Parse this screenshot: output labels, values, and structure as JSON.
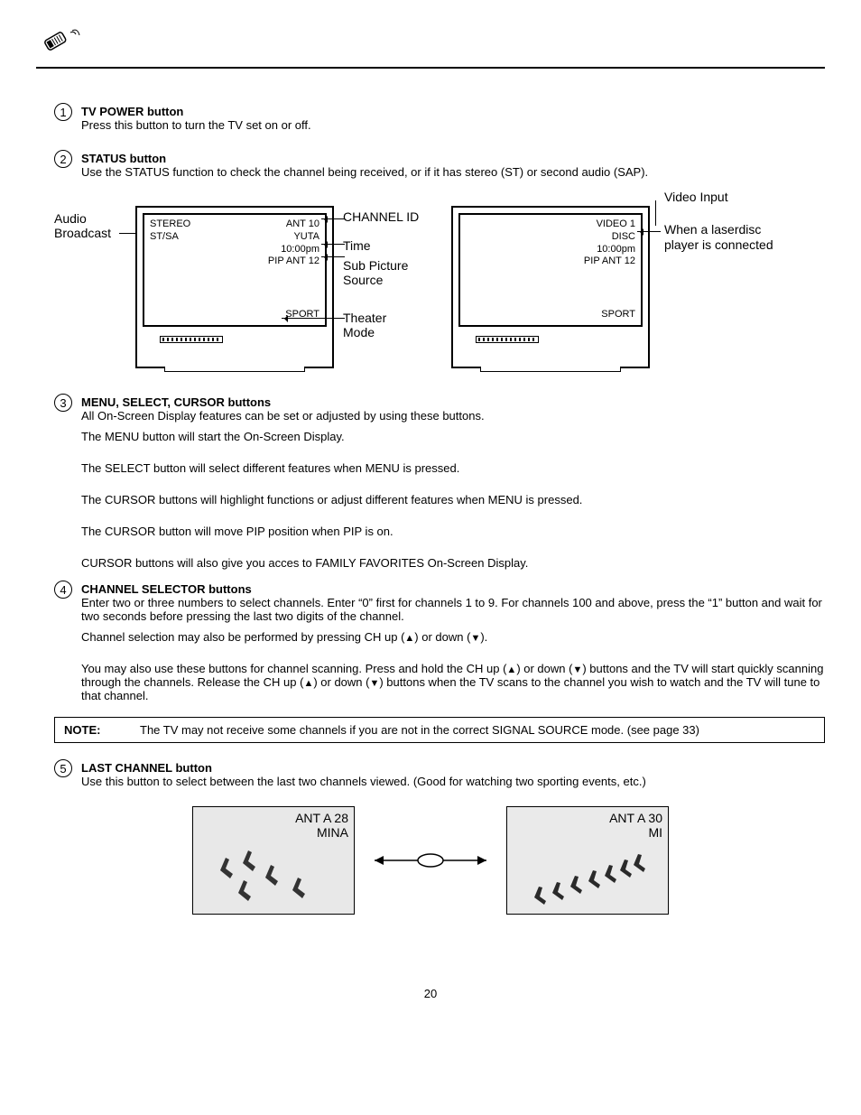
{
  "items": {
    "i1": {
      "num": "1",
      "title": "TV POWER button",
      "desc": "Press this button to turn the TV set on or off."
    },
    "i2": {
      "num": "2",
      "title": "STATUS button",
      "desc": "Use the STATUS function to check the channel being received, or if it has stereo (ST) or second audio (SAP)."
    },
    "i3": {
      "num": "3",
      "title": "MENU, SELECT, CURSOR buttons",
      "p1": "All On-Screen Display features can be set or adjusted by using these buttons.",
      "p2": "The MENU button will start the On-Screen Display.",
      "p3": "The SELECT button will select different features when MENU is pressed.",
      "p4": "The CURSOR buttons will highlight functions or adjust different features when MENU is pressed.",
      "p5": "The CURSOR button will move PIP position when PIP is on.",
      "p6": "CURSOR buttons will also give you acces to FAMILY FAVORITES On-Screen Display."
    },
    "i4": {
      "num": "4",
      "title": "CHANNEL SELECTOR buttons",
      "p1": "Enter two or three numbers to select channels.  Enter “0” first for channels 1 to 9.  For channels 100 and above, press the “1” button and wait for two seconds before pressing the last two digits of the channel.",
      "p2_a": "Channel selection may also be performed by pressing CH up (",
      "p2_b": ") or down (",
      "p2_c": ").",
      "p3_a": "You may also use these buttons for channel scanning.  Press and hold the CH up (",
      "p3_b": ") or down (",
      "p3_c": ") buttons and the TV will start quickly scanning through the channels.  Release the CH up (",
      "p3_d": ") or down (",
      "p3_e": ") buttons when the TV scans to the channel you wish to watch and the TV will tune to that channel."
    },
    "i5": {
      "num": "5",
      "title": "LAST CHANNEL button",
      "desc": "Use this button to select between the last two channels viewed.  (Good for watching two sporting events, etc.)"
    }
  },
  "note": {
    "label": "NOTE:",
    "text": "The TV may not receive some channels if you are not in the correct SIGNAL SOURCE mode.  (see page 33)"
  },
  "diagram": {
    "left_label_1": "Audio",
    "left_label_2": "Broadcast",
    "tv1": {
      "l1": "STEREO",
      "l2": "ST/SA",
      "r1": "ANT 10",
      "r2": "YUTA",
      "r3": "10:00pm",
      "r4": "PIP ANT 12",
      "sport": "SPORT"
    },
    "mid": {
      "c1": "CHANNEL ID",
      "c2": "Time",
      "c3": "Sub Picture",
      "c4": "Source",
      "c5": "Theater",
      "c6": "Mode"
    },
    "tv2": {
      "r1": "VIDEO 1",
      "r2": "DISC",
      "r3": "10:00pm",
      "r4": "PIP ANT 12",
      "sport": "SPORT"
    },
    "right": {
      "l1": "Video Input",
      "l2": "When a laserdisc",
      "l3": "player is connected"
    }
  },
  "photos": {
    "left": {
      "l1": "ANT A 28",
      "l2": "MINA"
    },
    "right": {
      "l1": "ANT A 30",
      "l2": "MI"
    }
  },
  "tri_up": "▲",
  "tri_down": "▼",
  "page": "20"
}
